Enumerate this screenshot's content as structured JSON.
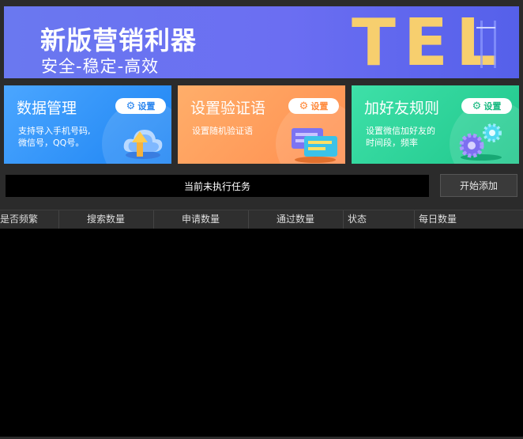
{
  "banner": {
    "title": "新版营销利器",
    "subtitle": "安全-稳定-高效",
    "logo_text": "TEL"
  },
  "cards": [
    {
      "title": "数据管理",
      "desc_line1": "支持导入手机号码,",
      "desc_line2": "微信号，QQ号。",
      "button": "设置",
      "icon": "cloud-upload-icon"
    },
    {
      "title": "设置验证语",
      "desc_line1": "设置随机验证语",
      "desc_line2": "",
      "button": "设置",
      "icon": "chat-bubbles-icon"
    },
    {
      "title": "加好友规则",
      "desc_line1": "设置微信加好友的",
      "desc_line2": "时间段，频率",
      "button": "设置",
      "icon": "gears-icon"
    }
  ],
  "task": {
    "status_text": "当前未执行任务",
    "start_button": "开始添加"
  },
  "table": {
    "columns": [
      "是否频繁",
      "搜索数量",
      "申请数量",
      "通过数量",
      "状态",
      "每日数量"
    ],
    "rows": []
  },
  "colors": {
    "banner": "#6b6ef2",
    "card_blue": "#1d84f3",
    "card_orange": "#ff8f50",
    "card_green": "#20c78c",
    "logo_yellow": "#f7cf6e"
  }
}
